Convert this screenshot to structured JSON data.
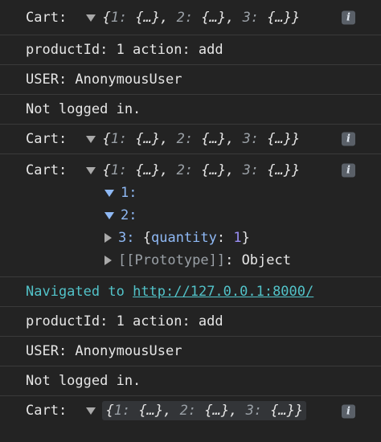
{
  "rows": {
    "cart1": {
      "label": "Cart:",
      "preview": {
        "k1": "1:",
        "v1": "{…},",
        "k2": "2:",
        "v2": "{…},",
        "k3": "3:",
        "v3": "{…}}",
        "open": "{"
      }
    },
    "product1": {
      "text": "productId: 1 action: add"
    },
    "user1": {
      "text": "USER: AnonymousUser"
    },
    "notlogged1": {
      "text": "Not logged in."
    },
    "cart2": {
      "label": "Cart:",
      "preview": {
        "k1": "1:",
        "v1": "{…},",
        "k2": "2:",
        "v2": "{…},",
        "k3": "3:",
        "v3": "{…}}",
        "open": "{"
      }
    },
    "cart3": {
      "label": "Cart:",
      "preview": {
        "k1": "1:",
        "v1": "{…},",
        "k2": "2:",
        "v2": "{…},",
        "k3": "3:",
        "v3": "{…}}",
        "open": "{"
      },
      "children": {
        "c1_key": "1:",
        "c2_key": "2:",
        "c3_key": "3:",
        "c3_open": "{",
        "c3_prop": "quantity",
        "c3_colon": ":",
        "c3_val": "1",
        "c3_close": "}",
        "proto_label": "[[Prototype]]",
        "proto_colon": ":",
        "proto_value": "Object"
      }
    },
    "navigated": {
      "prefix": "Navigated to",
      "url": "http://127.0.0.1:8000/"
    },
    "product2": {
      "text": "productId: 1 action: add"
    },
    "user2": {
      "text": "USER: AnonymousUser"
    },
    "notlogged2": {
      "text": "Not logged in."
    },
    "cart4": {
      "label": "Cart:",
      "preview": {
        "k1": "1:",
        "v1": "{…},",
        "k2": "2:",
        "v2": "{…},",
        "k3": "3:",
        "v3": "{…}}",
        "open": "{"
      }
    }
  },
  "info_glyph": "i",
  "colors": {
    "background": "#232323",
    "text": "#e6e6e6",
    "key_blue": "#8fb9f5",
    "number_purple": "#9a8ff5",
    "navigated_teal": "#52c2c8"
  }
}
